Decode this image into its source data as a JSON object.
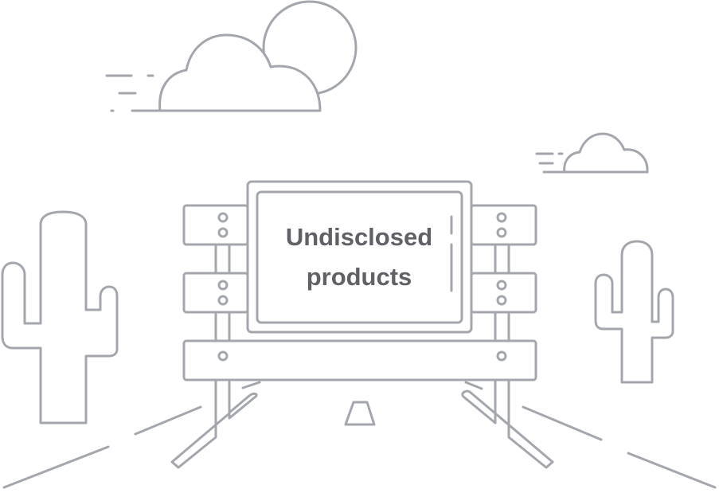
{
  "illustration": {
    "sign_text": {
      "line1": "Undisclosed",
      "line2": "products"
    },
    "colors": {
      "stroke": "#a3a7ad",
      "text": "#5f6166",
      "background": "#ffffff"
    },
    "icons": [
      "sun-icon",
      "cloud-icon",
      "cactus-icon",
      "road-barrier-sign-icon",
      "road-icon"
    ]
  }
}
